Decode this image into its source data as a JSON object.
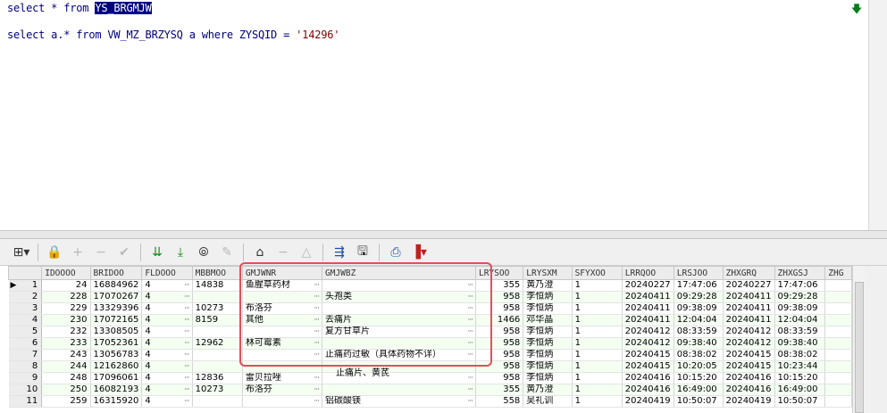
{
  "editor": {
    "line1_prefix": "select * from ",
    "line1_selected": "YS_BRGMJW",
    "line2_prefix": "select a.* from VW_MZ_BRZYSQ a where ZYSQID = ",
    "line2_string": "'14296'",
    "execute_icon": "arrow-down-icon"
  },
  "toolbar": {
    "icons": [
      "grid-menu-icon",
      "lock-icon",
      "add-icon",
      "remove-icon",
      "check-icon",
      "next-icon",
      "last-icon",
      "binoculars-icon",
      "clear-icon",
      "query-icon",
      "up-icon",
      "down-icon",
      "link-icon",
      "save-icon",
      "print-icon",
      "chart-icon"
    ]
  },
  "grid": {
    "columns": [
      "IDOOOO",
      "BRIDOO",
      "FLDOOO",
      "MBBMOO",
      "GMJWNR",
      "GMJWBZ",
      "LRYSOO",
      "LRYSXM",
      "SFYXOO",
      "LRRQOO",
      "LRSJOO",
      "ZHXGRQ",
      "ZHXGSJ",
      "ZHG"
    ],
    "rows": [
      [
        "1",
        "24",
        "16884962",
        "4",
        "14838",
        "鱼腥草药材",
        "",
        "355",
        "黄乃澄",
        "1",
        "20240227",
        "17:47:06",
        "20240227",
        "17:47:06"
      ],
      [
        "2",
        "228",
        "17070267",
        "4",
        "",
        "",
        "头孢类",
        "958",
        "李恒炳",
        "1",
        "20240411",
        "09:29:28",
        "20240411",
        "09:29:28"
      ],
      [
        "3",
        "229",
        "13329396",
        "4",
        "10273",
        "布洛芬",
        "",
        "958",
        "李恒炳",
        "1",
        "20240411",
        "09:38:09",
        "20240411",
        "09:38:09"
      ],
      [
        "4",
        "230",
        "17072165",
        "4",
        "8159",
        "其他",
        "去痛片",
        "1466",
        "邓华晶",
        "1",
        "20240411",
        "12:04:04",
        "20240411",
        "12:04:04"
      ],
      [
        "5",
        "232",
        "13308505",
        "4",
        "",
        "",
        "复方甘草片",
        "958",
        "李恒炳",
        "1",
        "20240412",
        "08:33:59",
        "20240412",
        "08:33:59"
      ],
      [
        "6",
        "233",
        "17052361",
        "4",
        "12962",
        "林可霉素",
        "",
        "958",
        "李恒炳",
        "1",
        "20240412",
        "09:38:40",
        "20240412",
        "09:38:40"
      ],
      [
        "7",
        "243",
        "13056783",
        "4",
        "",
        "",
        "止痛药过敏（具体药物不详）",
        "958",
        "李恒炳",
        "1",
        "20240415",
        "08:38:02",
        "20240415",
        "08:38:02"
      ],
      [
        "8",
        "244",
        "12162860",
        "4",
        "",
        "",
        "",
        "958",
        "李恒炳",
        "1",
        "20240415",
        "10:20:05",
        "20240415",
        "10:23:44"
      ],
      [
        "9",
        "248",
        "17096061",
        "4",
        "12836",
        "雷贝拉唑",
        "",
        "958",
        "李恒炳",
        "1",
        "20240416",
        "10:15:20",
        "20240416",
        "10:15:20"
      ],
      [
        "10",
        "250",
        "16082193",
        "4",
        "10273",
        "布洛芬",
        "",
        "355",
        "黄乃澄",
        "1",
        "20240416",
        "16:49:00",
        "20240416",
        "16:49:00"
      ],
      [
        "11",
        "259",
        "16315920",
        "4",
        "",
        "",
        "铝碳酸镁",
        "558",
        "吴礼训",
        "1",
        "20240419",
        "10:50:07",
        "20240419",
        "10:50:07"
      ]
    ],
    "overflow_text": "止痛片、黄芪"
  }
}
